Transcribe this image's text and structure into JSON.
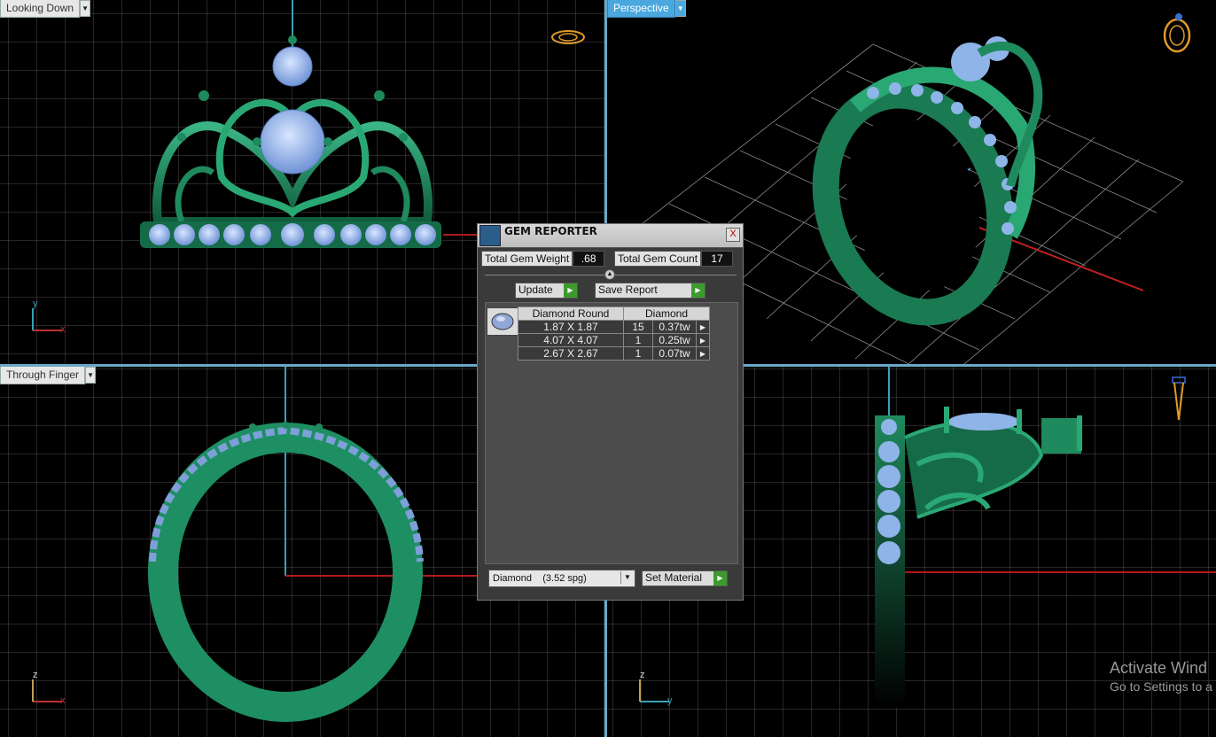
{
  "viewports": {
    "top_left": {
      "label": "Looking Down",
      "axis_h": "x",
      "axis_v": "y"
    },
    "top_right": {
      "label": "Perspective"
    },
    "bottom_left": {
      "label": "Through Finger",
      "axis_h": "x",
      "axis_v": "z"
    },
    "bottom_right": {
      "axis_h": "y",
      "axis_v": "z"
    }
  },
  "dialog": {
    "title": "GEM REPORTER",
    "close": "X",
    "total_weight_label": "Total Gem Weight",
    "total_weight_value": ".68",
    "total_count_label": "Total Gem Count",
    "total_count_value": "17",
    "update_label": "Update",
    "save_report_label": "Save Report",
    "table": {
      "header": [
        "Diamond Round",
        "Diamond"
      ],
      "rows": [
        {
          "size": "1.87 X 1.87",
          "count": "15",
          "weight": "0.37tw"
        },
        {
          "size": "4.07 X 4.07",
          "count": "1",
          "weight": "0.25tw"
        },
        {
          "size": "2.67 X 2.67",
          "count": "1",
          "weight": "0.07tw"
        }
      ]
    },
    "material_value": "Diamond    (3.52 spg)",
    "set_material_label": "Set Material"
  },
  "watermark": {
    "line1": "Activate Wind",
    "line2": "Go to Settings to a"
  },
  "colors": {
    "grid": "#4d4d4d",
    "metal": "#1f8a5e",
    "gem": "#8fb4e8",
    "active_tab": "#4aa8de"
  }
}
